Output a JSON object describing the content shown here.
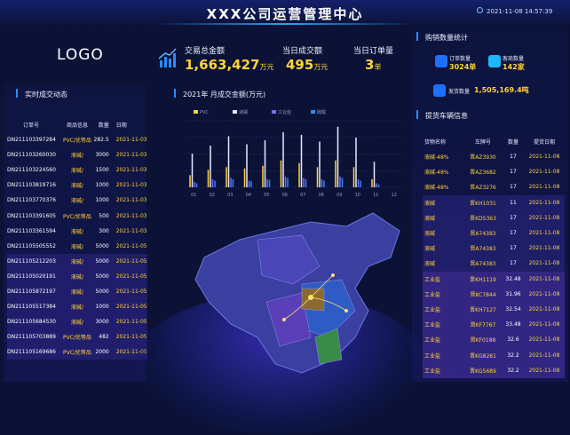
{
  "header": {
    "title": "XXX公司运营管理中心",
    "datetime": "2021-11-08 14:57:39"
  },
  "logo": "LOGO",
  "kpis": [
    {
      "label": "交易总金额",
      "value": "1,663,427",
      "unit": "万元"
    },
    {
      "label": "当日成交额",
      "value": "495",
      "unit": "万元"
    },
    {
      "label": "当日订单量",
      "value": "3",
      "unit": "单"
    }
  ],
  "left_panel": {
    "title": "实时成交动态",
    "columns": [
      "订单号",
      "商品信息",
      "数量",
      "日期"
    ],
    "rows": [
      {
        "order": "DN211103397284",
        "goods": "PVC/优等品",
        "qty": "282.5",
        "date": "2021-11-03"
      },
      {
        "order": "DN211103260030",
        "goods": "液碱/",
        "qty": "3000",
        "date": "2021-11-03"
      },
      {
        "order": "DN211103224560",
        "goods": "液碱/",
        "qty": "1500",
        "date": "2021-11-03"
      },
      {
        "order": "DN211103819716",
        "goods": "液碱/",
        "qty": "1000",
        "date": "2021-11-03"
      },
      {
        "order": "DN211103770376",
        "goods": "液碱/",
        "qty": "1000",
        "date": "2021-11-03"
      },
      {
        "order": "DN211103391605",
        "goods": "PVC/优等品",
        "qty": "500",
        "date": "2021-11-03"
      },
      {
        "order": "DN211103361594",
        "goods": "液碱/",
        "qty": "300",
        "date": "2021-11-03"
      },
      {
        "order": "DN211105505552",
        "goods": "液碱/",
        "qty": "5000",
        "date": "2021-11-05"
      },
      {
        "order": "DN211105212203",
        "goods": "液碱/",
        "qty": "5000",
        "date": "2021-11-05"
      },
      {
        "order": "DN211105020191",
        "goods": "液碱/",
        "qty": "5000",
        "date": "2021-11-05"
      },
      {
        "order": "DN211105872197",
        "goods": "液碱/",
        "qty": "5000",
        "date": "2021-11-05"
      },
      {
        "order": "DN211105517384",
        "goods": "液碱/",
        "qty": "1000",
        "date": "2021-11-05"
      },
      {
        "order": "DN211105684530",
        "goods": "液碱/",
        "qty": "3000",
        "date": "2021-11-05"
      },
      {
        "order": "DN211105703889",
        "goods": "PVC/优等品",
        "qty": "482",
        "date": "2021-11-05"
      },
      {
        "order": "DN211105169686",
        "goods": "PVC/优等品",
        "qty": "2000",
        "date": "2021-11-05"
      }
    ]
  },
  "chart_data": {
    "type": "bar",
    "title": "2021年 月成交金额(万元)",
    "categories": [
      "01",
      "02",
      "03",
      "04",
      "05",
      "06",
      "07",
      "08",
      "09",
      "10",
      "11",
      "12"
    ],
    "series": [
      {
        "name": "PVC",
        "values": [
          18,
          26,
          30,
          28,
          32,
          40,
          36,
          30,
          40,
          30,
          12,
          0
        ]
      },
      {
        "name": "液碱",
        "values": [
          50,
          62,
          76,
          64,
          70,
          82,
          78,
          68,
          90,
          74,
          38,
          0
        ]
      },
      {
        "name": "工业盐",
        "values": [
          8,
          12,
          14,
          10,
          12,
          16,
          14,
          12,
          16,
          12,
          6,
          0
        ]
      },
      {
        "name": "硫酸",
        "values": [
          6,
          10,
          12,
          9,
          11,
          14,
          12,
          10,
          14,
          10,
          4,
          0
        ]
      }
    ]
  },
  "right_panel": {
    "purchase_title": "购销数量统计",
    "orders_label": "订单数量",
    "orders_value": "3024单",
    "customers_label": "客商数量",
    "customers_value": "142家",
    "shipments_label": "发货数量",
    "shipments_value": "1,505,169.4吨",
    "vehicle_title": "提货车辆信息",
    "columns": [
      "货物名称",
      "车牌号",
      "数量",
      "提货日期"
    ],
    "rows": [
      {
        "goods": "液碱-48%",
        "plate": "晋AZ3930",
        "qty": "17",
        "date": "2021-11-08"
      },
      {
        "goods": "液碱-48%",
        "plate": "晋AZ3682",
        "qty": "17",
        "date": "2021-11-08"
      },
      {
        "goods": "液碱-48%",
        "plate": "晋AZ3276",
        "qty": "17",
        "date": "2021-11-08"
      },
      {
        "goods": "液碱",
        "plate": "晋KH1031",
        "qty": "11",
        "date": "2021-11-08"
      },
      {
        "goods": "液碱",
        "plate": "晋KD5363",
        "qty": "17",
        "date": "2021-11-08"
      },
      {
        "goods": "液碱",
        "plate": "晋A74383",
        "qty": "17",
        "date": "2021-11-08"
      },
      {
        "goods": "液碱",
        "plate": "晋A74383",
        "qty": "17",
        "date": "2021-11-08"
      },
      {
        "goods": "液碱",
        "plate": "晋A74383",
        "qty": "17",
        "date": "2021-11-08"
      },
      {
        "goods": "工业盐",
        "plate": "晋KH1119",
        "qty": "32.48",
        "date": "2021-11-08"
      },
      {
        "goods": "工业盐",
        "plate": "晋KC7844",
        "qty": "31.96",
        "date": "2021-11-08"
      },
      {
        "goods": "工业盐",
        "plate": "晋KH7127",
        "qty": "32.54",
        "date": "2021-11-08"
      },
      {
        "goods": "工业盐",
        "plate": "晋KF7767",
        "qty": "33.48",
        "date": "2021-11-08"
      },
      {
        "goods": "工业盐",
        "plate": "晋KF0188",
        "qty": "32.6",
        "date": "2021-11-08"
      },
      {
        "goods": "工业盐",
        "plate": "晋KG8281",
        "qty": "32.2",
        "date": "2021-11-08"
      },
      {
        "goods": "工业盐",
        "plate": "晋KG5689",
        "qty": "32.2",
        "date": "2021-11-08"
      }
    ]
  }
}
